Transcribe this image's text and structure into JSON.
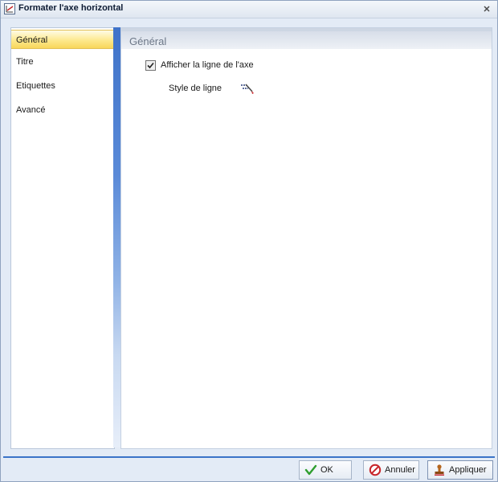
{
  "window": {
    "title": "Formater l'axe horizontal",
    "close_icon": "close-icon"
  },
  "sidebar": {
    "items": [
      {
        "label": "Général",
        "selected": true
      },
      {
        "label": "Titre",
        "selected": false
      },
      {
        "label": "Etiquettes",
        "selected": false
      },
      {
        "label": "Avancé",
        "selected": false
      }
    ]
  },
  "content": {
    "section_title": "Général",
    "show_axis_line": {
      "label": "Afficher la ligne de l'axe",
      "checked": true
    },
    "line_style": {
      "label": "Style de ligne",
      "icon": "line-style-icon"
    }
  },
  "footer": {
    "ok_label": "OK",
    "cancel_label": "Annuler",
    "apply_label": "Appliquer"
  },
  "colors": {
    "accent_blue": "#3b74c8",
    "selected_item": "#fde98e",
    "check_green": "#2e9e2e",
    "cancel_red": "#c8262b"
  }
}
